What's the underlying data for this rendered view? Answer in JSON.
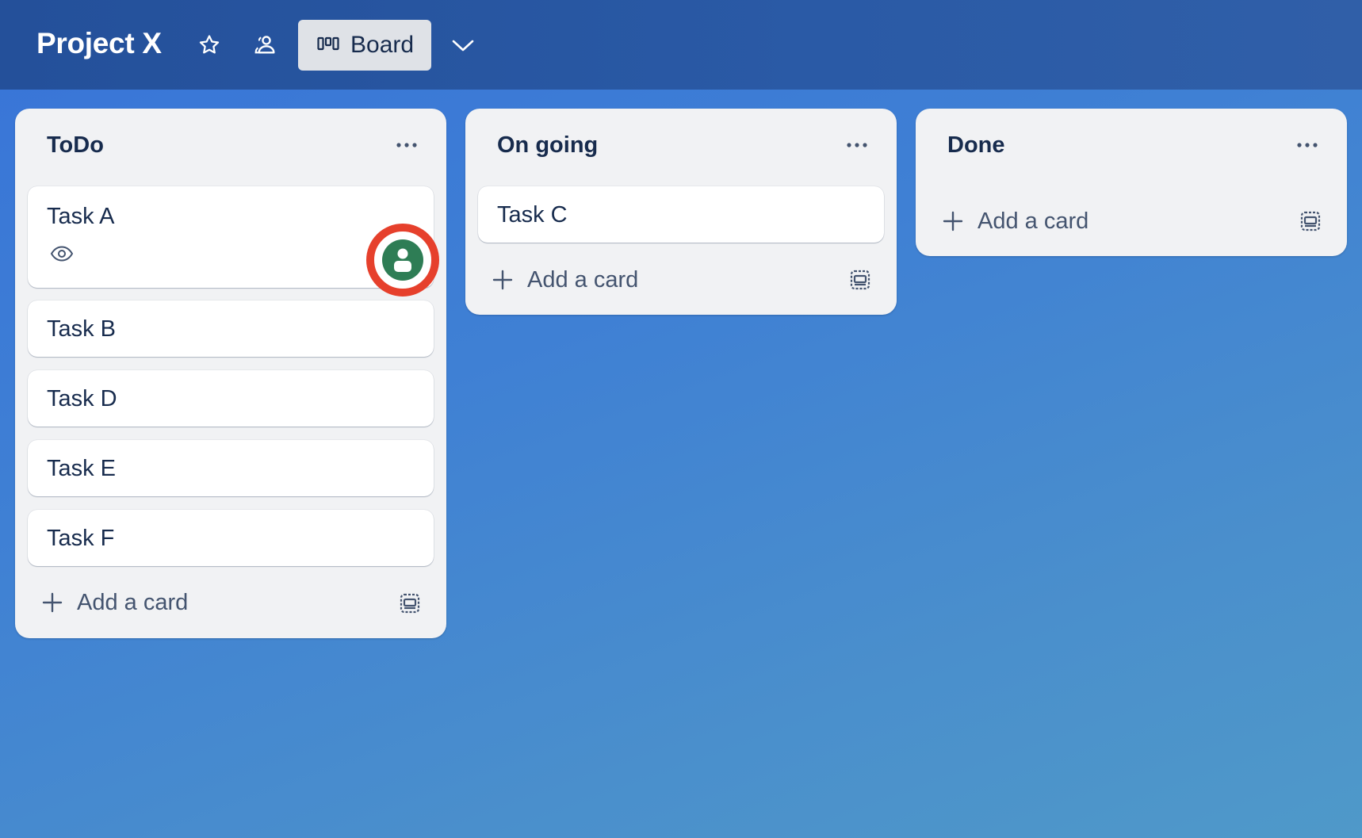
{
  "header": {
    "board_title": "Project X",
    "view_label": "Board",
    "icons": [
      "star-icon",
      "workspace-visibility-icon",
      "board-view-icon",
      "chevron-down-icon"
    ]
  },
  "lists": [
    {
      "title": "ToDo",
      "cards": [
        {
          "title": "Task A",
          "badges": [
            "watching-eye-icon"
          ],
          "member_avatar": true
        },
        {
          "title": "Task B"
        },
        {
          "title": "Task D"
        },
        {
          "title": "Task E"
        },
        {
          "title": "Task F"
        }
      ],
      "add_card_label": "Add a card"
    },
    {
      "title": "On going",
      "cards": [
        {
          "title": "Task C"
        }
      ],
      "add_card_label": "Add a card"
    },
    {
      "title": "Done",
      "cards": [],
      "add_card_label": "Add a card"
    }
  ],
  "colors": {
    "header_bg": "#2a5aa6",
    "board_bg": "#3f80d4",
    "list_bg": "#f1f2f4",
    "card_bg": "#ffffff",
    "text": "#172b4d",
    "avatar": "#2e7d55",
    "highlight_ring": "#e6402c"
  }
}
